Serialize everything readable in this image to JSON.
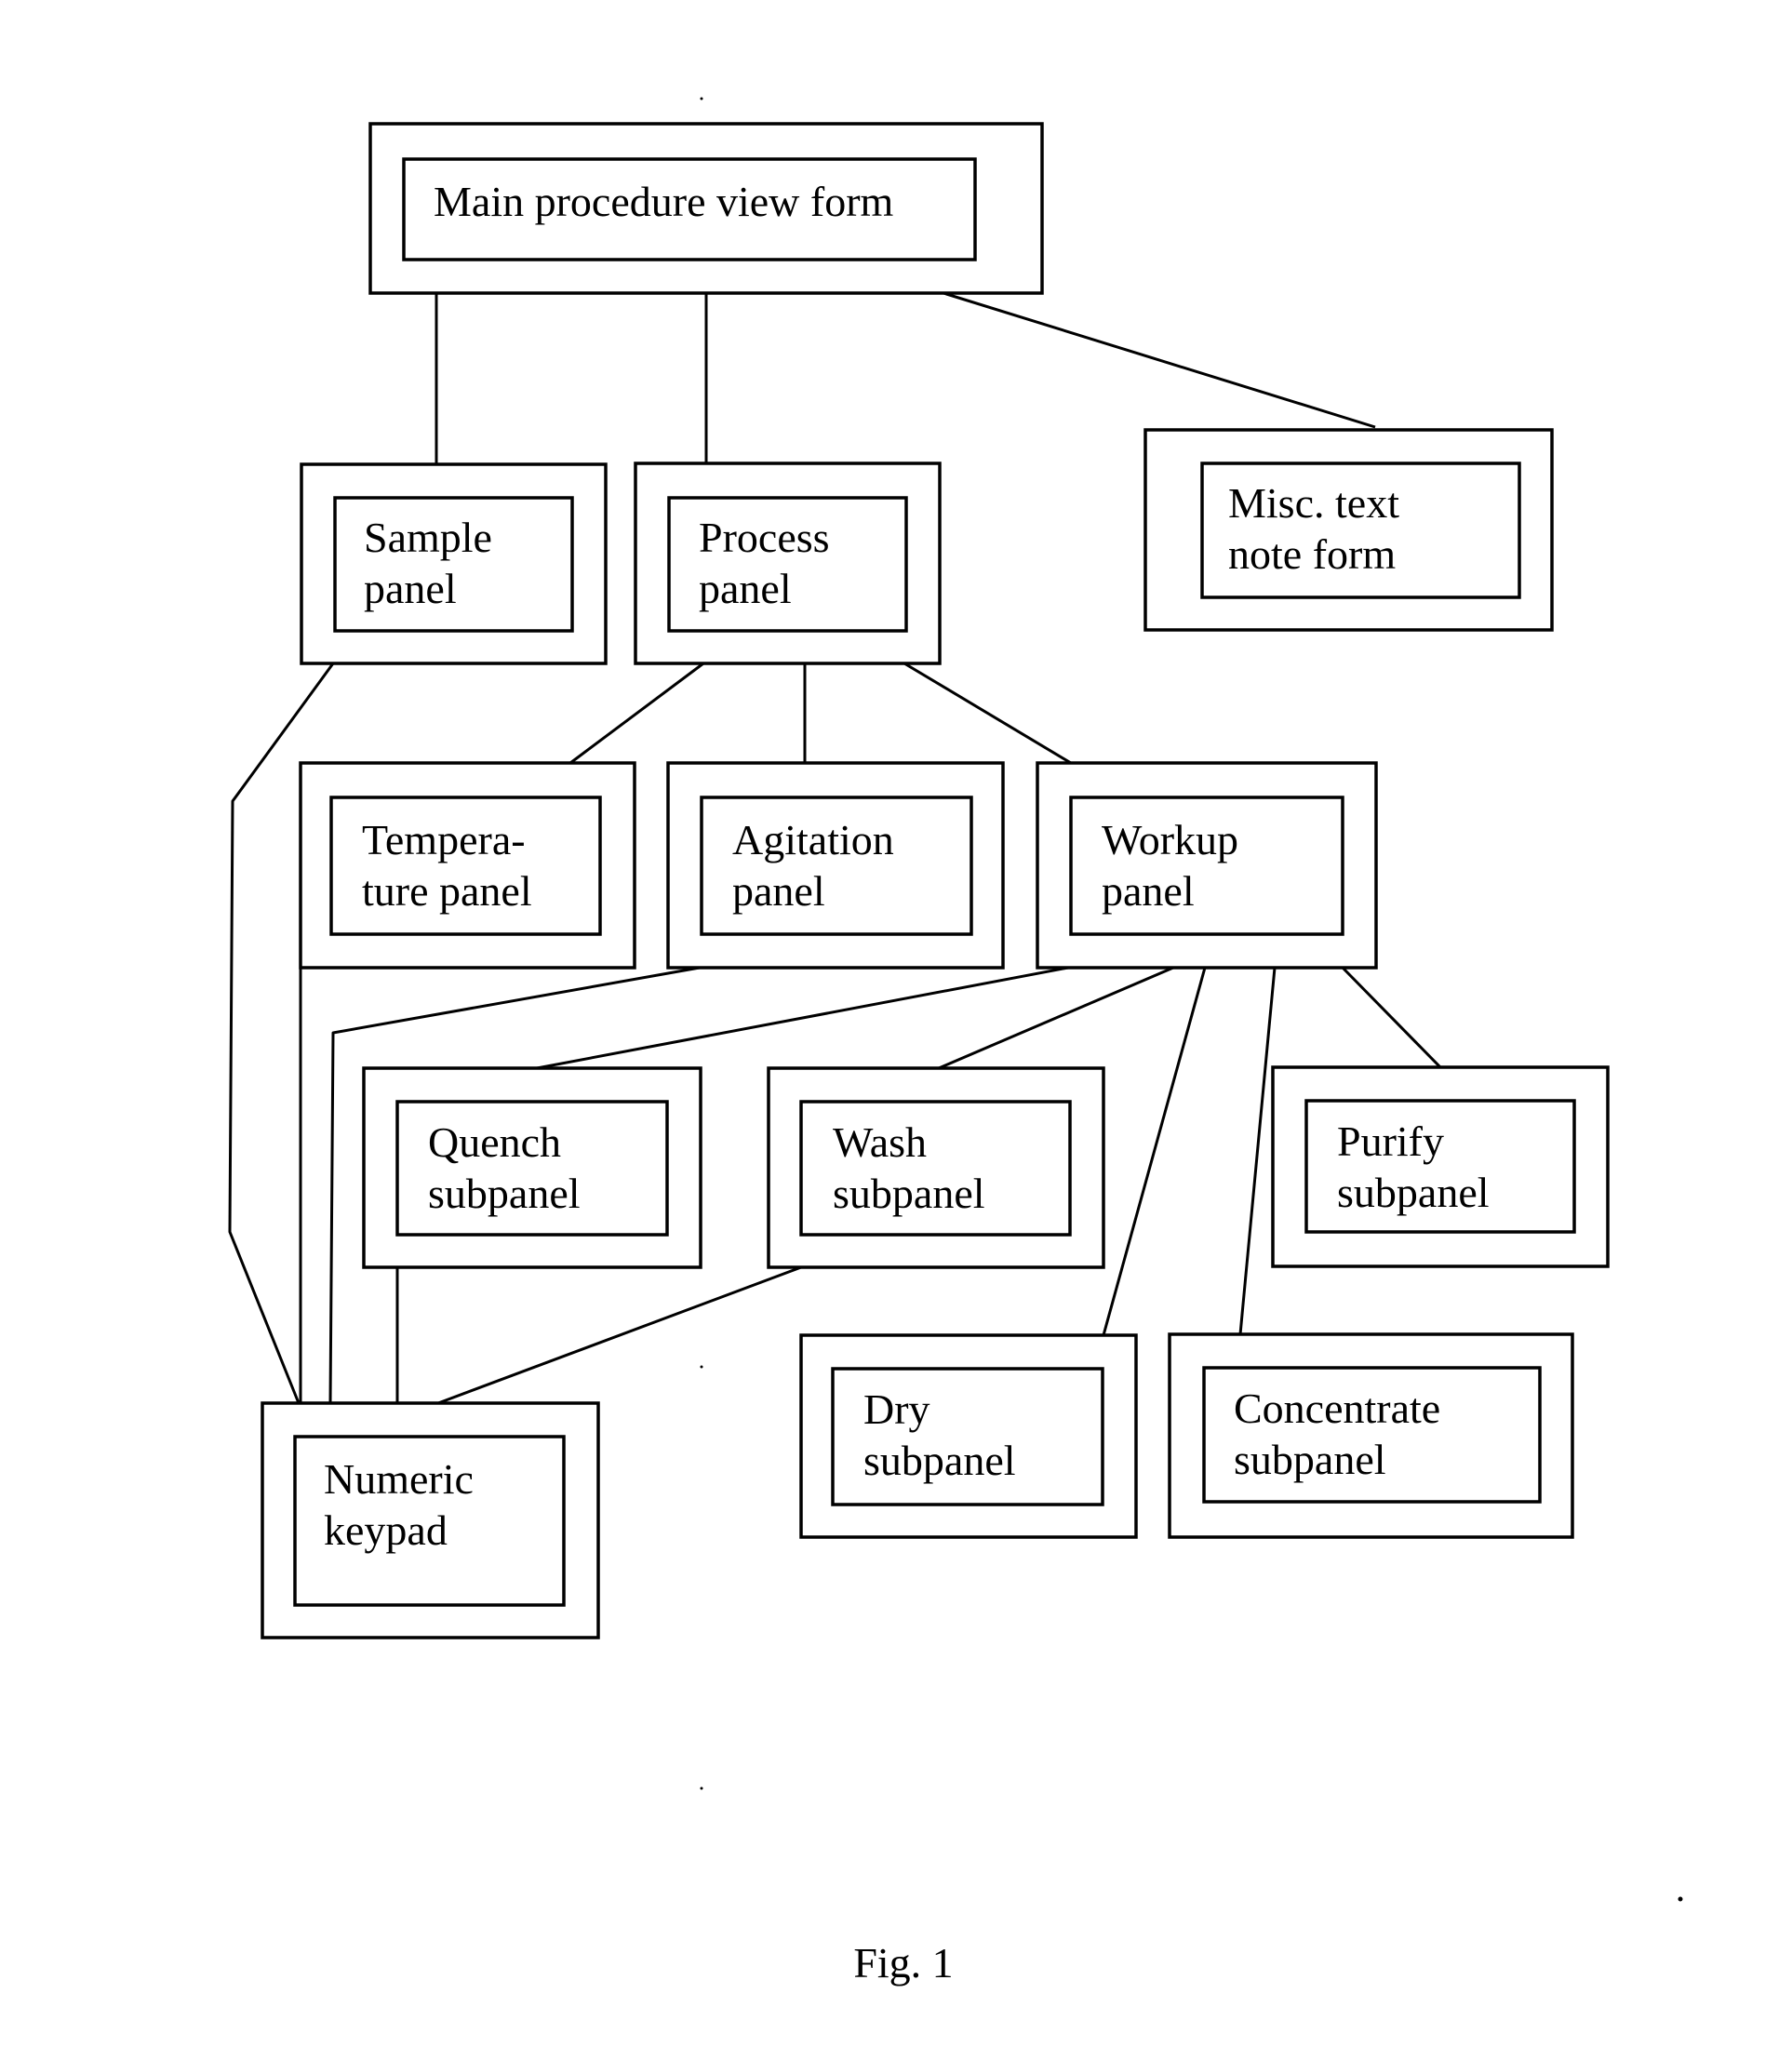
{
  "figure": {
    "caption": "Fig. 1",
    "nodes": [
      {
        "id": "main",
        "lines": [
          "Main procedure view form"
        ]
      },
      {
        "id": "sample",
        "lines": [
          "Sample",
          "panel"
        ]
      },
      {
        "id": "process",
        "lines": [
          "Process",
          "panel"
        ]
      },
      {
        "id": "misc",
        "lines": [
          "Misc. text",
          "note form"
        ]
      },
      {
        "id": "temperature",
        "lines": [
          "Tempera-",
          "ture panel"
        ]
      },
      {
        "id": "agitation",
        "lines": [
          "Agitation",
          "panel"
        ]
      },
      {
        "id": "workup",
        "lines": [
          "Workup",
          "panel"
        ]
      },
      {
        "id": "quench",
        "lines": [
          "Quench",
          "subpanel"
        ]
      },
      {
        "id": "wash",
        "lines": [
          "Wash",
          "subpanel"
        ]
      },
      {
        "id": "purify",
        "lines": [
          "Purify",
          "subpanel"
        ]
      },
      {
        "id": "dry",
        "lines": [
          "Dry",
          "subpanel"
        ]
      },
      {
        "id": "concentrate",
        "lines": [
          "Concentrate",
          "subpanel"
        ]
      },
      {
        "id": "numeric",
        "lines": [
          "Numeric",
          "keypad"
        ]
      }
    ],
    "edges": [
      {
        "from": "main",
        "to": "sample"
      },
      {
        "from": "main",
        "to": "process"
      },
      {
        "from": "main",
        "to": "misc"
      },
      {
        "from": "sample",
        "to": "numeric"
      },
      {
        "from": "process",
        "to": "temperature"
      },
      {
        "from": "process",
        "to": "agitation"
      },
      {
        "from": "process",
        "to": "workup"
      },
      {
        "from": "temperature",
        "to": "numeric"
      },
      {
        "from": "agitation",
        "to": "numeric"
      },
      {
        "from": "workup",
        "to": "quench"
      },
      {
        "from": "workup",
        "to": "wash"
      },
      {
        "from": "workup",
        "to": "dry"
      },
      {
        "from": "workup",
        "to": "concentrate"
      },
      {
        "from": "workup",
        "to": "purify"
      },
      {
        "from": "quench",
        "to": "numeric"
      },
      {
        "from": "wash",
        "to": "numeric"
      }
    ]
  }
}
